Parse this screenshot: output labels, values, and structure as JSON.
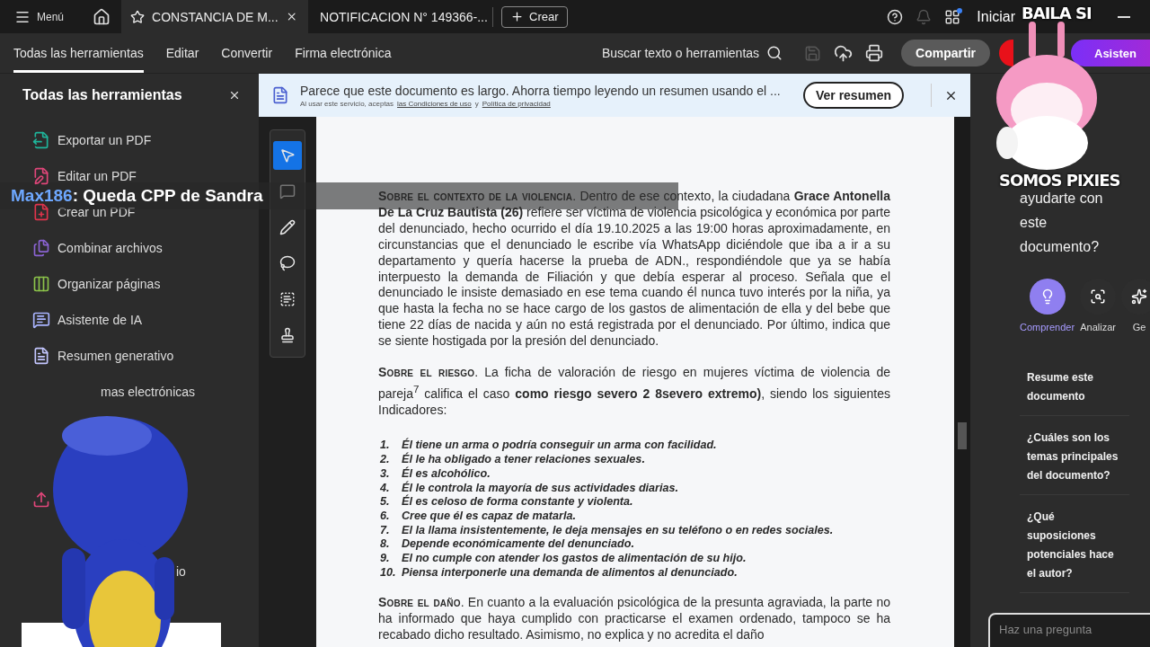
{
  "top_bar": {
    "menu_label": "Menú",
    "tabs": [
      {
        "title": "CONSTANCIA DE M...",
        "selected": true
      },
      {
        "title": "NOTIFICACION N° 149366-...",
        "selected": false
      }
    ],
    "create_label": "Crear",
    "sign_in_label": "Iniciar"
  },
  "toolbar": {
    "menus": [
      {
        "label": "Todas las herramientas",
        "selected": true
      },
      {
        "label": "Editar",
        "selected": false
      },
      {
        "label": "Convertir",
        "selected": false
      },
      {
        "label": "Firma electrónica",
        "selected": false
      }
    ],
    "search_label": "Buscar texto o herramientas",
    "share_label": "Compartir",
    "assistant_label": "Asisten"
  },
  "tools_panel": {
    "title": "Todas las herramientas",
    "items": [
      {
        "kind": "tool",
        "label": "Exportar un PDF",
        "color": "#1fb59b"
      },
      {
        "kind": "tool",
        "label": "Editar un PDF",
        "color": "#e0467a"
      },
      {
        "kind": "tool",
        "label": "Crear un PDF",
        "color": "#e0344c"
      },
      {
        "kind": "tool",
        "label": "Combinar archivos",
        "color": "#8a63d2"
      },
      {
        "kind": "tool",
        "label": "Organizar páginas",
        "color": "#8bc34a"
      },
      {
        "kind": "tool",
        "label": "Asistente de IA",
        "color": "#a9b4ff"
      },
      {
        "kind": "tool",
        "label": "Resumen generativo",
        "color": "#c3c6ff"
      },
      {
        "kind": "partial",
        "label": "mas electrónicas"
      },
      {
        "kind": "covered"
      },
      {
        "kind": "covered"
      },
      {
        "kind": "icon",
        "color": "#e0467a"
      },
      {
        "kind": "covered"
      },
      {
        "kind": "partial",
        "label": "io"
      }
    ]
  },
  "banner": {
    "message": "Parece que este documento es largo. Ahorra tiempo leyendo un resumen usando el ...",
    "terms_prefix": "Al usar este servicio, aceptas",
    "terms_link": "las Condiciones de uso",
    "terms_joiner": "y",
    "privacy_link": "Política de privacidad",
    "action_label": "Ver resumen"
  },
  "tool_rail": [
    {
      "kind": "select",
      "selected": true
    },
    {
      "kind": "comment",
      "selected": false
    },
    {
      "kind": "draw",
      "selected": false
    },
    {
      "kind": "lasso",
      "selected": false
    },
    {
      "kind": "text",
      "selected": false
    },
    {
      "kind": "stamp",
      "selected": false
    }
  ],
  "document": {
    "blocks": [
      {
        "kind": "paragraph",
        "heading": "Sobre el contexto de la violencia",
        "text": ". Dentro de ese contexto, la ciudadana **Grace Antonella De La Cruz Bautista (26)** refiere ser víctima de violencia psicológica y económica por parte del denunciado, hecho ocurrido el día 19.10.2025 a las 19:00 horas aproximadamente, en circunstancias que el denunciado le escribe vía WhatsApp diciéndole que iba a ir a su departamento y quería hacerse la prueba de ADN., respondiéndole que ya se había interpuesto la demanda de Filiación y que debía esperar al proceso. Señala que el denunciado le insiste demasiado en ese tema cuando él nunca tuvo interés por la niña, ya que hasta la fecha no se hace cargo de los gastos de alimentación de ella y del bebe que tiene 22 días de nacida y aún no está registrada por el denunciado. Por último, indica que se siente hostigada por la presión del denunciado."
      },
      {
        "kind": "paragraph",
        "heading": "Sobre el riesgo",
        "text": ". La ficha de valoración de riesgo en mujeres víctima de violencia de pareja$^{7}$ califica el caso **como riesgo severo 2 8severo extremo)**, siendo los siguientes Indicadores:"
      },
      {
        "kind": "list",
        "items": [
          {
            "number": "1.",
            "text": "Él tiene un arma o podría conseguir un arma con facilidad."
          },
          {
            "number": "2.",
            "text": "Él le ha obligado a tener relaciones sexuales."
          },
          {
            "number": "3.",
            "text": "Él es alcohólico."
          },
          {
            "number": "4.",
            "text": "Él le controla la mayoría de sus actividades diarias."
          },
          {
            "number": "5.",
            "text": "Él es celoso de forma constante y violenta."
          },
          {
            "number": "6.",
            "text": "Cree que él es capaz de matarla."
          },
          {
            "number": "7.",
            "text": "El la llama insistentemente, le deja mensajes en su teléfono o en redes sociales."
          },
          {
            "number": "8.",
            "text": "Depende económicamente del denunciado."
          },
          {
            "number": "9.",
            "text": "El no cumple con atender los gastos de alimentación de su hijo."
          },
          {
            "number": "10.",
            "text": "Piensa interponerle una demanda de alimentos al denunciado."
          }
        ]
      },
      {
        "kind": "paragraph",
        "heading": "Sobre el daño",
        "text": ". En cuanto a la evaluación psicológica de la presunta agraviada, la parte no ha informado que haya cumplido con practicarse el examen ordenado, tampoco se ha recabado dicho resultado. Asimismo, no explica y no acredita el daño"
      }
    ]
  },
  "assistant_panel": {
    "greeting": "ayudarte con este documento?",
    "actions": [
      {
        "kind": "understand",
        "label": "Comprender",
        "selected": true
      },
      {
        "kind": "analyze",
        "label": "Analizar",
        "selected": false
      },
      {
        "kind": "generate",
        "label": "Ge",
        "selected": false
      }
    ],
    "suggestions": [
      "Resume este documento",
      "¿Cuáles son los temas principales del documento?",
      "¿Qué suposiciones potenciales hace el autor?"
    ],
    "input_placeholder": "Haz una pregunta"
  },
  "chat_overlay": {
    "user": "Max186",
    "message": ": Queda CPP de Sandra"
  },
  "sticker_captions": [
    "BAILA SI",
    "SOMOS PIXIES"
  ]
}
